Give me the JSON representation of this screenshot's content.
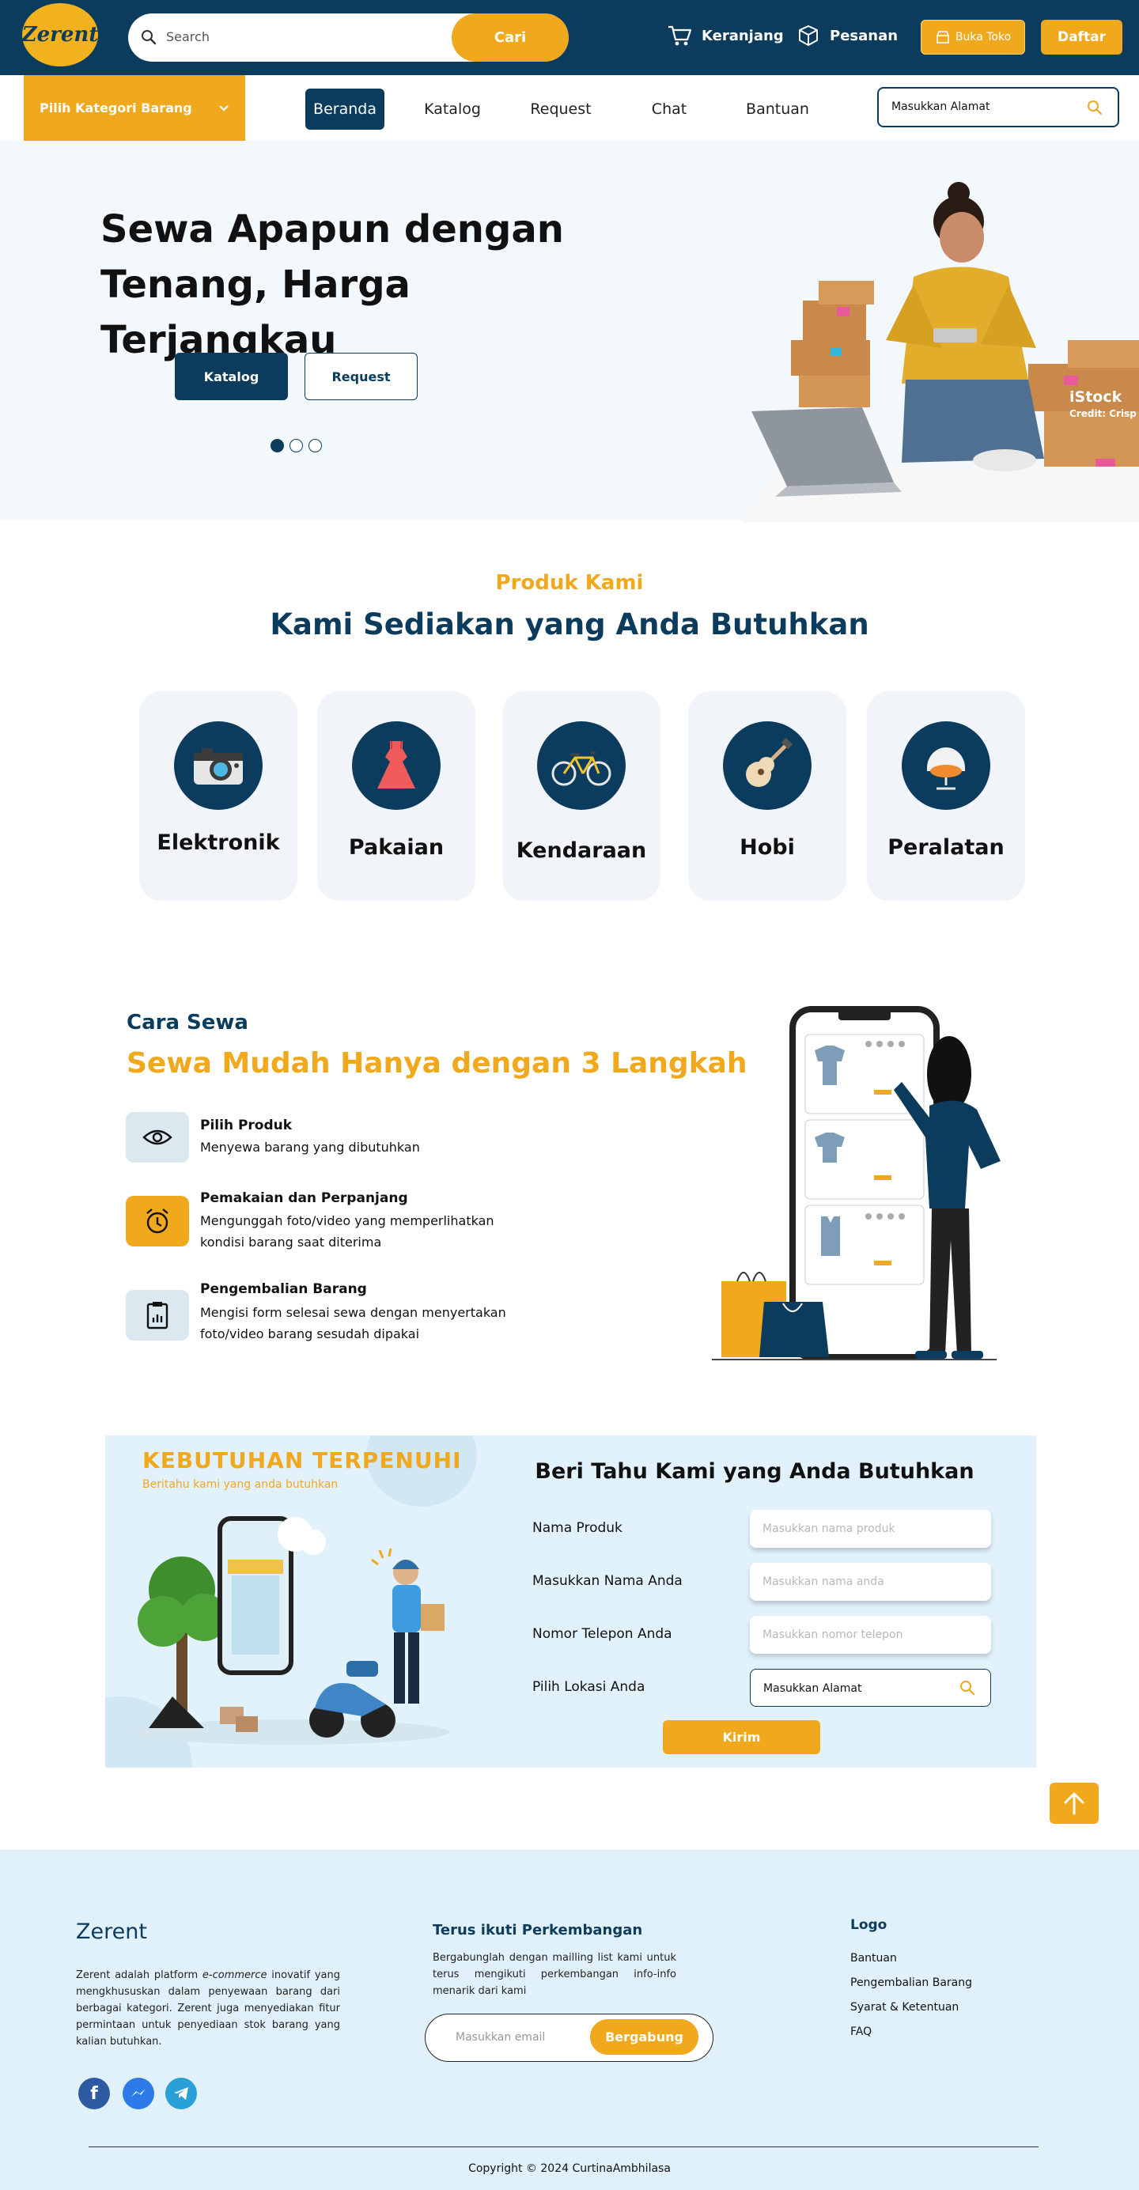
{
  "header": {
    "logo_text": "Zerent",
    "search_placeholder": "Search",
    "search_button": "Cari",
    "cart_label": "Keranjang",
    "orders_label": "Pesanan",
    "open_store_label": "Buka Toko",
    "register_label": "Daftar"
  },
  "nav": {
    "category_label": "Pilih Kategori Barang",
    "items": [
      "Beranda",
      "Katalog",
      "Request",
      "Chat",
      "Bantuan"
    ],
    "address_placeholder": "Masukkan Alamat"
  },
  "hero": {
    "title_line1": "Sewa Apapun dengan",
    "title_line2": "Tenang, Harga Terjangkau",
    "primary_button": "Katalog",
    "secondary_button": "Request",
    "slide_count": 3,
    "active_slide": 1,
    "watermark": "iStock",
    "watermark_credit": "Credit: Crisp"
  },
  "products": {
    "eyebrow": "Produk Kami",
    "heading": "Kami Sediakan yang Anda Butuhkan",
    "categories": [
      "Elektronik",
      "Pakaian",
      "Kendaraan",
      "Hobi",
      "Peralatan"
    ]
  },
  "how_to": {
    "eyebrow": "Cara Sewa",
    "heading": "Sewa Mudah Hanya dengan 3 Langkah",
    "steps": [
      {
        "title": "Pilih Produk",
        "desc": "Menyewa barang yang dibutuhkan"
      },
      {
        "title": "Pemakaian dan Perpanjang",
        "desc": "Mengunggah foto/video yang memperlihatkan kondisi barang saat diterima"
      },
      {
        "title": "Pengembalian Barang",
        "desc": "Mengisi form selesai sewa dengan menyertakan foto/video barang sesudah dipakai"
      }
    ]
  },
  "request_form": {
    "banner_title": "KEBUTUHAN TERPENUHI",
    "banner_sub": "Beritahu kami yang anda butuhkan",
    "heading": "Beri Tahu Kami yang Anda Butuhkan",
    "fields": [
      {
        "label": "Nama Produk",
        "placeholder": "Masukkan nama produk"
      },
      {
        "label": "Masukkan Nama Anda",
        "placeholder": "Masukkan nama anda"
      },
      {
        "label": "Nomor Telepon Anda",
        "placeholder": "Masukkan nomor telepon"
      },
      {
        "label": "Pilih Lokasi Anda",
        "placeholder": "Masukkan Alamat"
      }
    ],
    "submit_label": "Kirim"
  },
  "footer": {
    "brand": "Zerent",
    "about_before": "Zerent adalah platform ",
    "about_em": "e-commerce",
    "about_after": " inovatif yang mengkhususkan dalam penyewaan barang dari berbagai kategori. Zerent juga menyediakan fitur permintaan untuk penyediaan stok barang yang kalian butuhkan.",
    "newsletter_title": "Terus ikuti Perkembangan",
    "newsletter_desc": "Bergabunglah dengan mailling list kami untuk terus mengikuti perkembangan info-info menarik dari kami",
    "email_placeholder": "Masukkan email",
    "join_label": "Bergabung",
    "links_title": "Logo",
    "links": [
      "Bantuan",
      "Pengembalian Barang",
      "Syarat & Ketentuan",
      "FAQ"
    ],
    "copyright": "Copyright © 2024  CurtinaAmbhilasa"
  },
  "colors": {
    "primary": "#0b3c5d",
    "accent": "#f0a81c",
    "light_bg": "#e2f2fc"
  }
}
